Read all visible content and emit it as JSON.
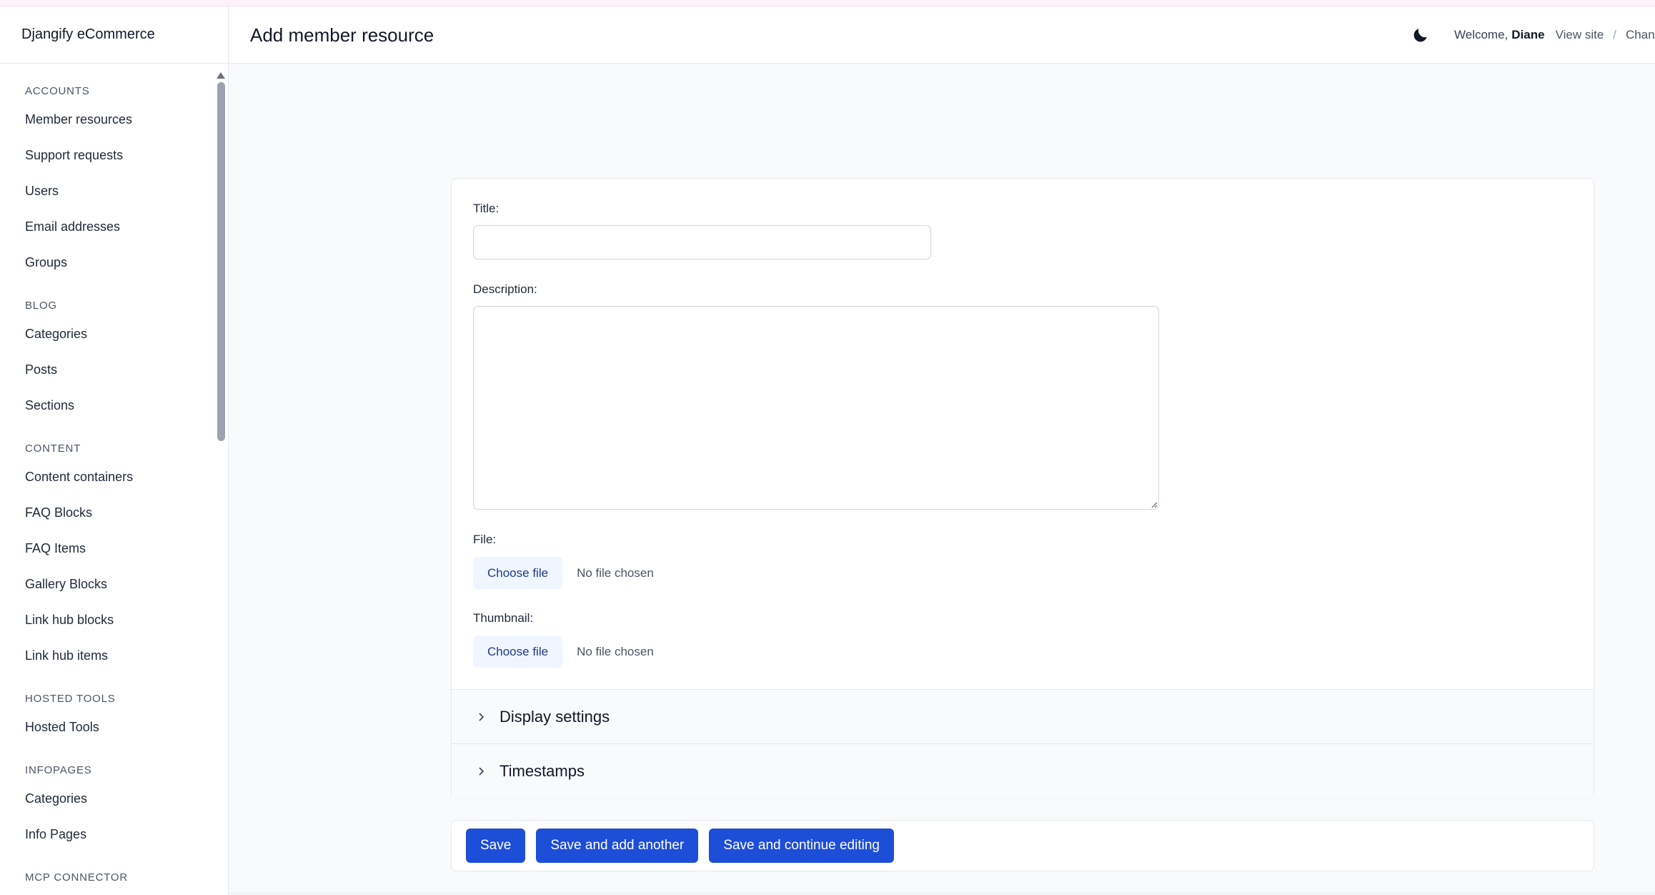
{
  "app": {
    "brand": "Djangify eCommerce"
  },
  "header": {
    "title": "Add member resource",
    "theme_icon": "moon-icon",
    "welcome": "Welcome,",
    "username": "Diane",
    "view_site": "View site",
    "separator": "/",
    "change_password": "Chan"
  },
  "sidebar": {
    "sections": [
      {
        "title": "ACCOUNTS",
        "items": [
          "Member resources",
          "Support requests",
          "Users",
          "Email addresses",
          "Groups"
        ]
      },
      {
        "title": "BLOG",
        "items": [
          "Categories",
          "Posts",
          "Sections"
        ]
      },
      {
        "title": "CONTENT",
        "items": [
          "Content containers",
          "FAQ Blocks",
          "FAQ Items",
          "Gallery Blocks",
          "Link hub blocks",
          "Link hub items"
        ]
      },
      {
        "title": "HOSTED TOOLS",
        "items": [
          "Hosted Tools"
        ]
      },
      {
        "title": "INFOPAGES",
        "items": [
          "Categories",
          "Info Pages"
        ]
      },
      {
        "title": "MCP CONNECTOR",
        "items": []
      }
    ]
  },
  "form": {
    "title_label": "Title:",
    "title_value": "",
    "description_label": "Description:",
    "description_value": "",
    "file_label": "File:",
    "thumbnail_label": "Thumbnail:",
    "choose_file": "Choose file",
    "no_file": "No file chosen",
    "fieldsets": [
      "Display settings",
      "Timestamps"
    ]
  },
  "actions": {
    "save": "Save",
    "save_add_another": "Save and add another",
    "save_continue": "Save and continue editing"
  },
  "colors": {
    "primary": "#1d4ed8",
    "file_button_bg": "#eff6ff"
  }
}
